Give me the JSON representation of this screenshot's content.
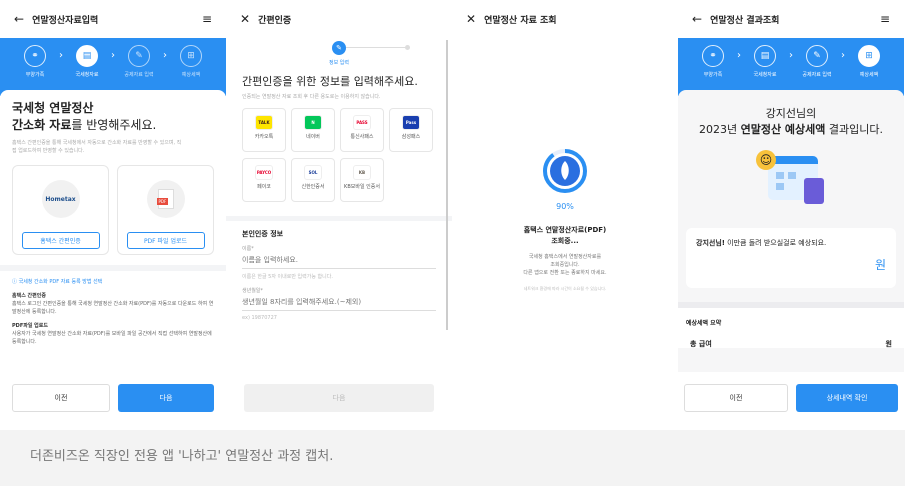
{
  "screen1": {
    "title": "연말정산자료입력",
    "back_icon": "arrow-left-icon",
    "menu_icon": "hamburger-icon",
    "steps": [
      "부양가족",
      "국세청자료",
      "공제자료 입력",
      "예상세액"
    ],
    "heading_line1": "국세청 연말정산",
    "heading_line2_bold": "간소화 자료",
    "heading_line2_rest": "를 반영해주세요.",
    "desc": "홈택스 간편인증을 통해 국세청에서 자동으로 간소화 자료를 반영할 수 있으며, 직접 업로드하여 반영할 수 있습니다.",
    "card1_label": "홈택스 간편인증",
    "card1_logo": "Hometax",
    "card2_label": "PDF 파일 업로드",
    "card2_logo": "PDF",
    "info_title": "국세청 간소화 PDF 자료 등록 방법 선택",
    "info1_title": "홈택스 간편인증",
    "info1_body": "홈택스 로그인 간편인증을 통해 국세청 연말정산 간소화 자료(PDF)를 자동으로 다운로드 하여 연말정산에 등록합니다.",
    "info2_title": "PDF파일 업로드",
    "info2_body": "사용자가 국세청 연말정산 간소화 자료(PDF)를 모바일 파일 공간에서 직접 선택하여 연말정산에 등록합니다.",
    "prev_button": "이전",
    "next_button": "다음"
  },
  "screen2": {
    "title": "간편인증",
    "close_icon": "close-icon",
    "progress_label": "정보 입력",
    "heading": "간편인증을 위한 정보를 입력해주세요.",
    "sub": "인증되는 연말정산 자료 조회 후 다른 용도로는 이용하지 않습니다.",
    "providers": [
      {
        "name": "카카오톡",
        "mark": "TALK",
        "bg": "#fee500",
        "fg": "#3b1e1e"
      },
      {
        "name": "네이버",
        "mark": "N",
        "bg": "#03c75a",
        "fg": "#ffffff"
      },
      {
        "name": "통신사패스",
        "mark": "PASS",
        "bg": "#ffffff",
        "fg": "#e6002d"
      },
      {
        "name": "삼성패스",
        "mark": "Pass",
        "bg": "#1a3fb0",
        "fg": "#ffffff"
      },
      {
        "name": "페이코",
        "mark": "PAYCO",
        "bg": "#ffffff",
        "fg": "#e6002d"
      },
      {
        "name": "신한인증서",
        "mark": "SOL",
        "bg": "#ffffff",
        "fg": "#1b3f9a"
      },
      {
        "name": "KB모바일 인증서",
        "mark": "KB",
        "bg": "#ffffff",
        "fg": "#60584c"
      }
    ],
    "section_title": "본인인증 정보",
    "name_label": "이름*",
    "name_placeholder": "이름을 입력하세요.",
    "name_hint": "이름은 한글 5자 이내로만 입력가능 합니다.",
    "birth_label": "생년월일*",
    "birth_placeholder": "생년월일 8자리를 입력해주세요.(~제외)",
    "birth_hint": "ex) 19870727",
    "next_button": "다음"
  },
  "screen3": {
    "title": "연말정산 자료 조회",
    "close_icon": "close-icon",
    "percent": "90%",
    "progress": 0.9,
    "heading1": "홈택스 연말정산자료(PDF)",
    "heading2": "조회중...",
    "body1": "국세청 홈택스에서 연말정산자료를",
    "body2": "조회중입니다.",
    "body3": "다른 앱으로 전환 또는 종료하지 마세요.",
    "note": "네트워크 환경에 따라 시간이 소요될 수 있습니다."
  },
  "screen4": {
    "title": "연말정산 결과조회",
    "back_icon": "arrow-left-icon",
    "menu_icon": "hamburger-icon",
    "steps": [
      "부양가족",
      "국세청자료",
      "공제자료 입력",
      "예상세액"
    ],
    "name_line": "강지선님의",
    "result_prefix": "2023년 ",
    "result_bold": "연말정산 예상세액",
    "result_suffix": " 결과입니다.",
    "refund_name": "강지선님!",
    "refund_text": " 이만큼 돌려 받으실걸로 예상되요.",
    "refund_unit": "원",
    "summary_title": "예상세액 요약",
    "summary_row_label": "총 급여",
    "summary_row_unit": "원",
    "prev_button": "이전",
    "detail_button": "상세내역 확인"
  },
  "caption": "더존비즈온 직장인 전용 앱 '나하고' 연말정산 과정 캡처.",
  "colors": {
    "accent": "#2a8ff2",
    "border": "#e2e2e2",
    "muted": "#999999"
  }
}
